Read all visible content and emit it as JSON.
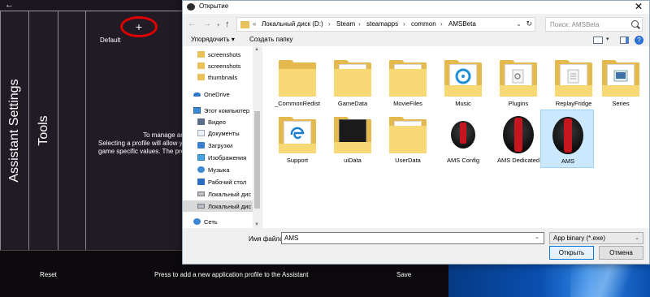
{
  "app": {
    "back_glyph": "←",
    "tabs": [
      "Assistant Settings",
      "Tools"
    ],
    "add_glyph": "+",
    "default_profile": "Default",
    "message_lines": [
      "To manage an",
      "Selecting a profile will allow you",
      "game specific values. The prev"
    ],
    "bottom": {
      "reset": "Reset",
      "hint": "Press to add a new application profile to the Assistant",
      "save": "Save"
    }
  },
  "dialog": {
    "title": "Открытие",
    "close": "✕",
    "nav": {
      "back": "←",
      "forward": "→",
      "recent": "▾",
      "up": "↑"
    },
    "address": {
      "overflow": "«",
      "crumbs": [
        "Локальный диск (D:)",
        "Steam",
        "steamapps",
        "common",
        "AMSBeta"
      ],
      "separator": "›",
      "dropdown": "⌄",
      "refresh": "↻"
    },
    "search_placeholder": "Поиск: AMSBeta",
    "toolbar": {
      "organize": "Упорядочить ▾",
      "new_folder": "Создать папку",
      "view_drop": "▾",
      "help": "?"
    },
    "nav_pane": [
      {
        "label": "screenshots",
        "icon": "folder-icon"
      },
      {
        "label": "screenshots",
        "icon": "folder-icon"
      },
      {
        "label": "thumbnails",
        "icon": "folder-icon"
      },
      {
        "label": "OneDrive",
        "icon": "onedrive-icon"
      },
      {
        "label": "Этот компьютер",
        "icon": "computer-icon"
      },
      {
        "label": "Видео",
        "icon": "video-icon"
      },
      {
        "label": "Документы",
        "icon": "documents-icon"
      },
      {
        "label": "Загрузки",
        "icon": "downloads-icon"
      },
      {
        "label": "Изображения",
        "icon": "pictures-icon"
      },
      {
        "label": "Музыка",
        "icon": "music-icon"
      },
      {
        "label": "Рабочий стол",
        "icon": "desktop-icon"
      },
      {
        "label": "Локальный дис",
        "icon": "drive-icon"
      },
      {
        "label": "Локальный дис",
        "icon": "drive-icon"
      },
      {
        "label": "Сеть",
        "icon": "network-icon"
      }
    ],
    "scroll": {
      "up": "▲",
      "down": "▼"
    },
    "files": [
      {
        "name": "_CommonRedist",
        "kind": "folder"
      },
      {
        "name": "GameData",
        "kind": "folder"
      },
      {
        "name": "MovieFiles",
        "kind": "folder"
      },
      {
        "name": "Music",
        "kind": "folder-music"
      },
      {
        "name": "Plugins",
        "kind": "folder-docs"
      },
      {
        "name": "ReplayFridge",
        "kind": "folder-docs"
      },
      {
        "name": "Series",
        "kind": "folder-image"
      },
      {
        "name": "Support",
        "kind": "folder-edge"
      },
      {
        "name": "uiData",
        "kind": "folder-dark"
      },
      {
        "name": "UserData",
        "kind": "folder"
      },
      {
        "name": "AMS Config",
        "kind": "exe-small"
      },
      {
        "name": "AMS Dedicated",
        "kind": "exe"
      },
      {
        "name": "AMS",
        "kind": "exe",
        "selected": true
      }
    ],
    "filename_label": "Имя файла:",
    "filename_value": "AMS",
    "filetype": "App binary (*.exe)",
    "dropdown_glyph": "⌄",
    "open": "Открыть",
    "cancel": "Отмена"
  }
}
